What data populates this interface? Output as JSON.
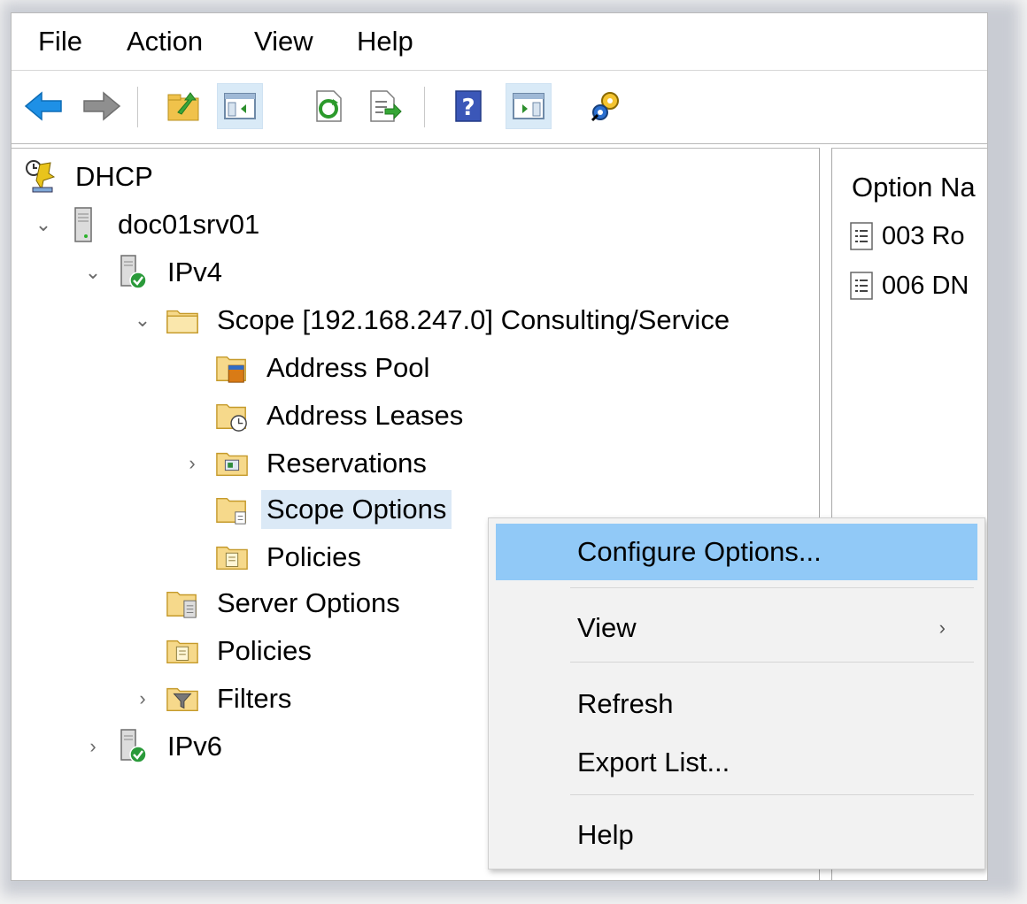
{
  "menubar": {
    "file": "File",
    "action": "Action",
    "view": "View",
    "help": "Help"
  },
  "toolbar": {
    "buttons": [
      "back-arrow-icon",
      "forward-arrow-icon",
      "up-folder-icon",
      "show-hide-console-tree-icon",
      "refresh-icon",
      "export-list-icon",
      "help-icon",
      "show-hide-action-pane-icon",
      "dhcp-properties-icon"
    ]
  },
  "tree": {
    "root": "DHCP",
    "server": "doc01srv01",
    "ipv4": "IPv4",
    "scope": "Scope [192.168.247.0] Consulting/Service",
    "address_pool": "Address Pool",
    "address_leases": "Address Leases",
    "reservations": "Reservations",
    "scope_options": "Scope Options",
    "scope_policies": "Policies",
    "server_options": "Server Options",
    "policies": "Policies",
    "filters": "Filters",
    "ipv6": "IPv6"
  },
  "detail": {
    "column_header": "Option Na",
    "rows": [
      "003 Ro",
      "006 DN"
    ]
  },
  "context_menu": {
    "configure_options": "Configure Options...",
    "view": "View",
    "refresh": "Refresh",
    "export_list": "Export List...",
    "help": "Help"
  },
  "colors": {
    "highlight": "#91c9f7",
    "selection": "#dbe9f6",
    "back_arrow": "#1e90e6"
  }
}
